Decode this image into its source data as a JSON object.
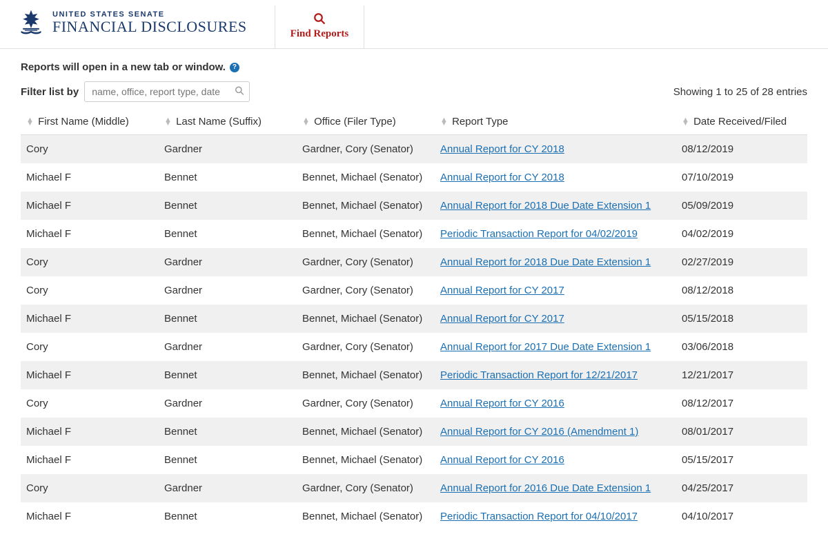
{
  "brand": {
    "top": "UNITED STATES SENATE",
    "bottom": "FINANCIAL DISCLOSURES"
  },
  "tab": {
    "label": "Find Reports"
  },
  "note": "Reports will open in a new tab or window.",
  "filter": {
    "label": "Filter list by",
    "placeholder": "name, office, report type, date"
  },
  "entries_info": "Showing 1 to 25 of 28 entries",
  "columns": {
    "first": "First Name (Middle)",
    "last": "Last Name (Suffix)",
    "office": "Office (Filer Type)",
    "type": "Report Type",
    "date": "Date Received/Filed"
  },
  "rows": [
    {
      "first": "Cory",
      "last": "Gardner",
      "office": "Gardner, Cory (Senator)",
      "type": "Annual Report for CY 2018",
      "date": "08/12/2019"
    },
    {
      "first": "Michael F",
      "last": "Bennet",
      "office": "Bennet, Michael (Senator)",
      "type": "Annual Report for CY 2018",
      "date": "07/10/2019"
    },
    {
      "first": "Michael F",
      "last": "Bennet",
      "office": "Bennet, Michael (Senator)",
      "type": "Annual Report for 2018 Due Date Extension 1",
      "date": "05/09/2019"
    },
    {
      "first": "Michael F",
      "last": "Bennet",
      "office": "Bennet, Michael (Senator)",
      "type": "Periodic Transaction Report for 04/02/2019",
      "date": "04/02/2019"
    },
    {
      "first": "Cory",
      "last": "Gardner",
      "office": "Gardner, Cory (Senator)",
      "type": "Annual Report for 2018 Due Date Extension 1",
      "date": "02/27/2019"
    },
    {
      "first": "Cory",
      "last": "Gardner",
      "office": "Gardner, Cory (Senator)",
      "type": "Annual Report for CY 2017",
      "date": "08/12/2018"
    },
    {
      "first": "Michael F",
      "last": "Bennet",
      "office": "Bennet, Michael (Senator)",
      "type": "Annual Report for CY 2017",
      "date": "05/15/2018"
    },
    {
      "first": "Cory",
      "last": "Gardner",
      "office": "Gardner, Cory (Senator)",
      "type": "Annual Report for 2017 Due Date Extension 1",
      "date": "03/06/2018"
    },
    {
      "first": "Michael F",
      "last": "Bennet",
      "office": "Bennet, Michael (Senator)",
      "type": "Periodic Transaction Report for 12/21/2017",
      "date": "12/21/2017"
    },
    {
      "first": "Cory",
      "last": "Gardner",
      "office": "Gardner, Cory (Senator)",
      "type": "Annual Report for CY 2016",
      "date": "08/12/2017"
    },
    {
      "first": "Michael F",
      "last": "Bennet",
      "office": "Bennet, Michael (Senator)",
      "type": "Annual Report for CY 2016 (Amendment 1)",
      "date": "08/01/2017"
    },
    {
      "first": "Michael F",
      "last": "Bennet",
      "office": "Bennet, Michael (Senator)",
      "type": "Annual Report for CY 2016",
      "date": "05/15/2017"
    },
    {
      "first": "Cory",
      "last": "Gardner",
      "office": "Gardner, Cory (Senator)",
      "type": "Annual Report for 2016 Due Date Extension 1",
      "date": "04/25/2017"
    },
    {
      "first": "Michael F",
      "last": "Bennet",
      "office": "Bennet, Michael (Senator)",
      "type": "Periodic Transaction Report for 04/10/2017",
      "date": "04/10/2017"
    }
  ]
}
